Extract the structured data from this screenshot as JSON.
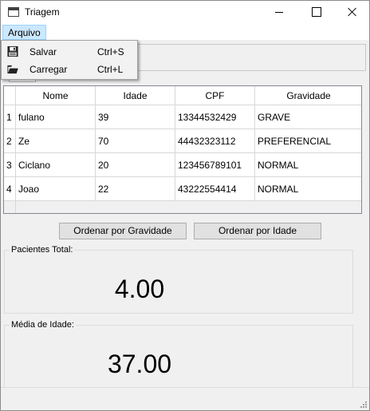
{
  "window": {
    "title": "Triagem"
  },
  "menu": {
    "arquivo_label": "Arquivo",
    "items": [
      {
        "label": "Salvar",
        "shortcut": "Ctrl+S",
        "icon": "save-icon"
      },
      {
        "label": "Carregar",
        "shortcut": "Ctrl+L",
        "icon": "folder-icon"
      }
    ]
  },
  "table": {
    "columns": [
      "Nome",
      "Idade",
      "CPF",
      "Gravidade"
    ],
    "rows": [
      {
        "num": "1",
        "cells": [
          "fulano",
          "39",
          "13344532429",
          "GRAVE"
        ]
      },
      {
        "num": "2",
        "cells": [
          "Ze",
          "70",
          "44432323112",
          "PREFERENCIAL"
        ]
      },
      {
        "num": "3",
        "cells": [
          "Ciclano",
          "20",
          "123456789101",
          "NORMAL"
        ]
      },
      {
        "num": "4",
        "cells": [
          "Joao",
          "22",
          "43222554414",
          "NORMAL"
        ]
      }
    ]
  },
  "buttons": {
    "sort_gravidade": "Ordenar por Gravidade",
    "sort_idade": "Ordenar por Idade"
  },
  "stats": {
    "total_label": "Pacientes Total:",
    "total_value": "4.00",
    "media_label": "Média de Idade:",
    "media_value": "37.00"
  }
}
